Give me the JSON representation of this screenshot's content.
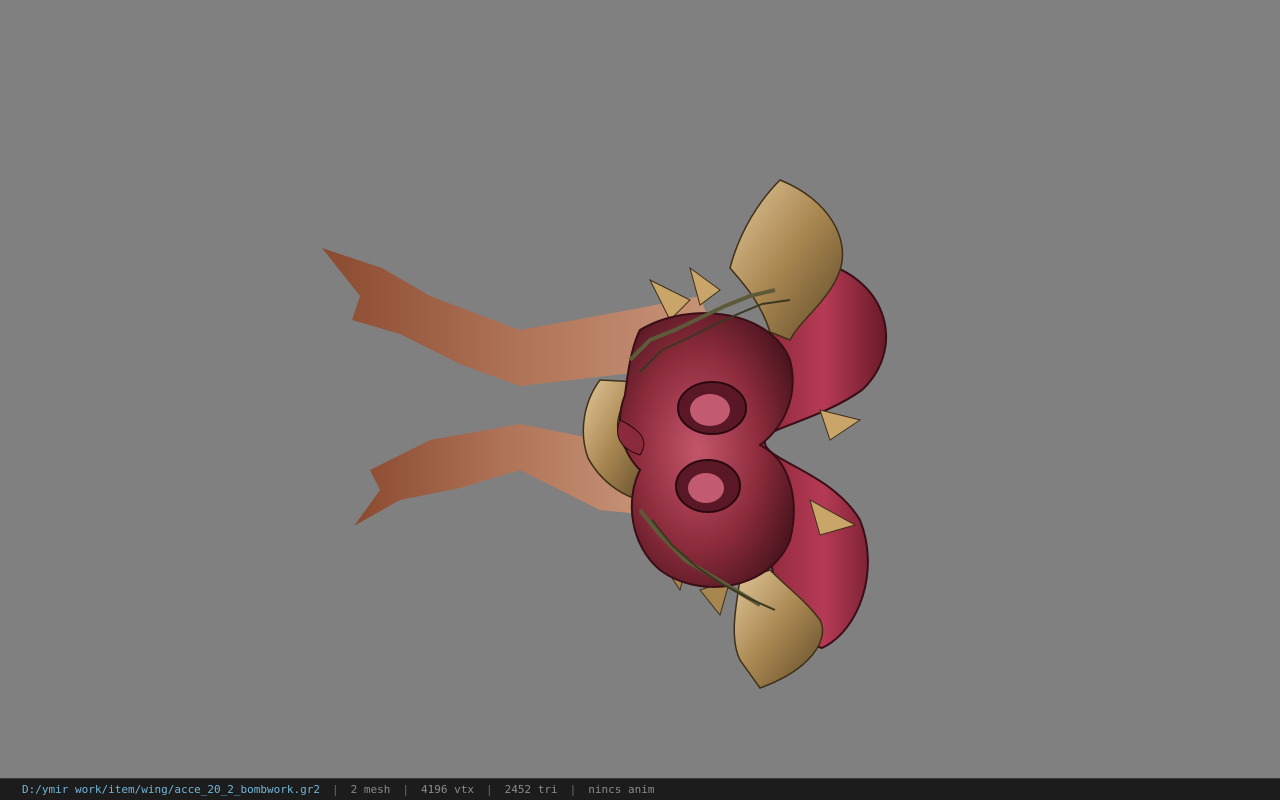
{
  "viewport": {
    "background": "#808080",
    "model": "wing accessory (red/gold mask with chains and ribbon tails)"
  },
  "statusbar": {
    "path": "D:/ymir work/item/wing/acce_20_2_bombwork.gr2",
    "mesh": "2 mesh",
    "vertices": "4196 vtx",
    "triangles": "2452 tri",
    "anim": "nincs anim",
    "separator": "|"
  }
}
